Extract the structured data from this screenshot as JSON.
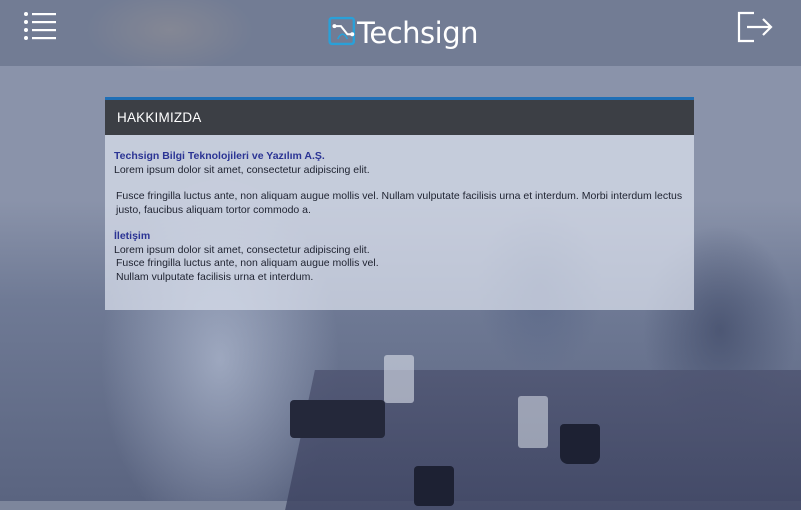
{
  "header": {
    "logo_text": "Techsign",
    "icons": {
      "menu": "hamburger-menu-icon",
      "logo": "techsign-logo-icon",
      "logout": "logout-icon"
    }
  },
  "panel": {
    "title": "HAKKIMIZDA",
    "accent_color": "#1f6fb6",
    "sections": [
      {
        "heading": "Techsign Bilgi Teknolojileri ve Yazılım A.Ş.",
        "line1": "Lorem ipsum dolor sit amet, consectetur adipiscing elit.",
        "para": "Fusce fringilla luctus ante, non aliquam augue mollis vel. Nullam vulputate facilisis urna et interdum. Morbi interdum lectus justo, faucibus aliquam tortor commodo a."
      },
      {
        "heading": "İletişim",
        "line1": "Lorem ipsum dolor sit amet, consectetur adipiscing elit.",
        "line2": "Fusce fringilla luctus ante, non aliquam augue mollis vel.",
        "line3": "Nullam vulputate facilisis urna et interdum."
      }
    ]
  }
}
